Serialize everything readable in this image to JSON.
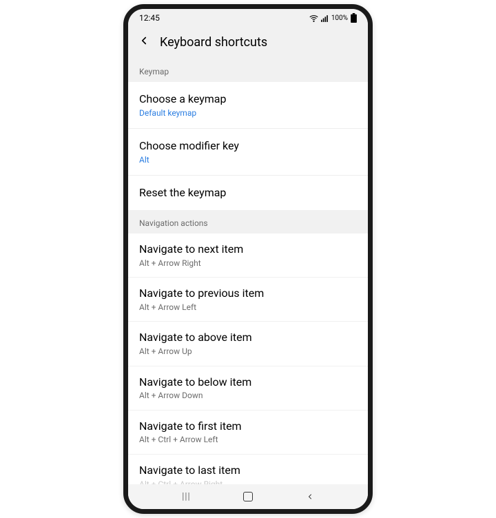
{
  "status": {
    "time": "12:45",
    "battery_pct": "100%"
  },
  "header": {
    "title": "Keyboard shortcuts"
  },
  "sections": [
    {
      "header": "Keymap",
      "rows": [
        {
          "title": "Choose a keymap",
          "sub": "Default keymap",
          "sub_blue": true
        },
        {
          "title": "Choose modifier key",
          "sub": "Alt",
          "sub_blue": true
        },
        {
          "title": "Reset the keymap",
          "sub": "",
          "sub_blue": false
        }
      ]
    },
    {
      "header": "Navigation actions",
      "rows": [
        {
          "title": "Navigate to next item",
          "sub": "Alt + Arrow Right",
          "sub_blue": false
        },
        {
          "title": "Navigate to previous item",
          "sub": "Alt + Arrow Left",
          "sub_blue": false
        },
        {
          "title": "Navigate to above item",
          "sub": "Alt + Arrow Up",
          "sub_blue": false
        },
        {
          "title": "Navigate to below item",
          "sub": "Alt + Arrow Down",
          "sub_blue": false
        },
        {
          "title": "Navigate to first item",
          "sub": "Alt + Ctrl + Arrow Left",
          "sub_blue": false
        },
        {
          "title": "Navigate to last item",
          "sub": "Alt + Ctrl + Arrow Right",
          "sub_blue": false
        }
      ]
    }
  ]
}
